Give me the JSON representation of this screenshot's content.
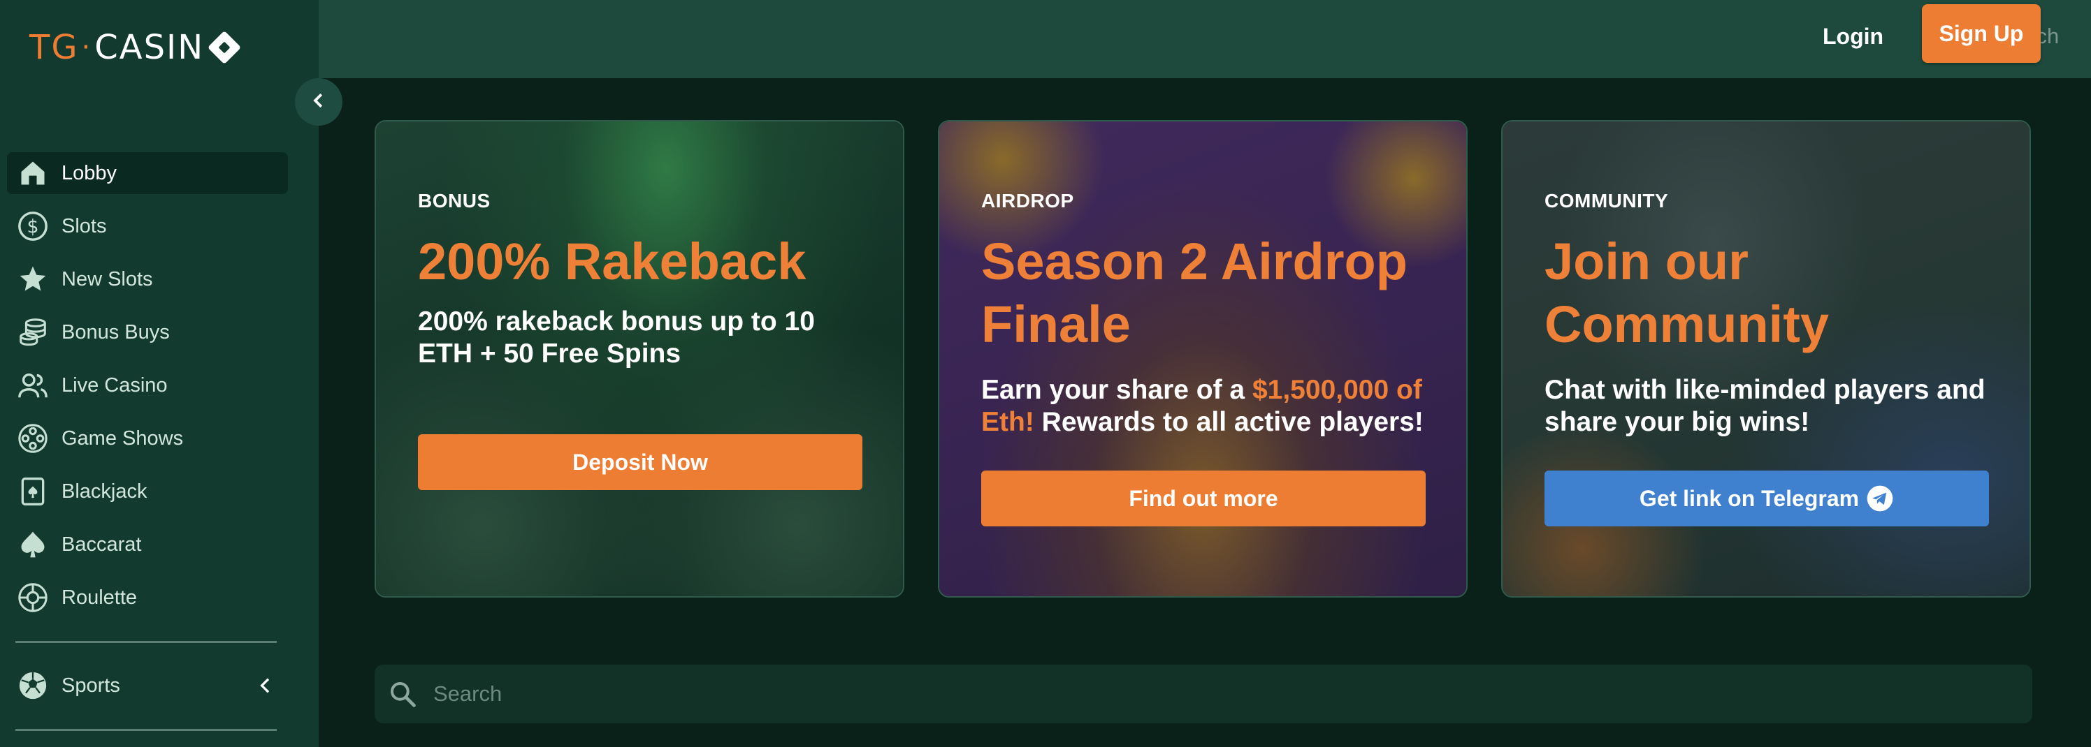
{
  "brand": {
    "logo_tg": "TG",
    "logo_dot": "·",
    "logo_casino": "CASIN"
  },
  "topbar": {
    "search_placeholder": "Search",
    "login_label": "Login",
    "signup_label": "Sign Up"
  },
  "sidebar": {
    "items": [
      {
        "label": "Lobby",
        "icon": "home-icon",
        "active": true
      },
      {
        "label": "Slots",
        "icon": "dollar-coin-icon"
      },
      {
        "label": "New Slots",
        "icon": "star-icon"
      },
      {
        "label": "Bonus Buys",
        "icon": "coin-stack-icon"
      },
      {
        "label": "Live Casino",
        "icon": "users-icon"
      },
      {
        "label": "Game Shows",
        "icon": "film-reel-icon"
      },
      {
        "label": "Blackjack",
        "icon": "playing-card-icon"
      },
      {
        "label": "Baccarat",
        "icon": "spade-icon"
      },
      {
        "label": "Roulette",
        "icon": "roulette-icon"
      }
    ],
    "sports_label": "Sports"
  },
  "promos": [
    {
      "tag": "BONUS",
      "title": "200% Rakeback",
      "description": "200% rakeback bonus up to 10 ETH + 50 Free Spins",
      "cta": "Deposit Now"
    },
    {
      "tag": "AIRDROP",
      "title": "Season 2 Airdrop Finale",
      "desc_pre": "Earn your share of a ",
      "desc_highlight": "$1,500,000 of Eth!",
      "desc_post": " Rewards to all active players!",
      "cta": "Find out more"
    },
    {
      "tag": "COMMUNITY",
      "title": "Join our Community",
      "description": "Chat with like-minded players and share your big wins!",
      "cta": "Get link on Telegram"
    }
  ],
  "main_search": {
    "placeholder": "Search"
  },
  "colors": {
    "accent": "#ee7d34",
    "sidebar_bg": "#123a2f",
    "topbar_bg": "#1d4a3d",
    "page_bg": "#0a211a",
    "telegram_blue": "#3f80cf"
  }
}
